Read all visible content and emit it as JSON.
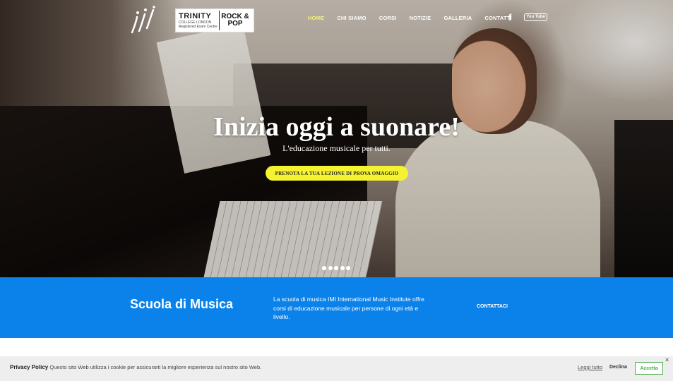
{
  "header": {
    "logo_alt": "IMI",
    "partner": {
      "name": "TRINITY",
      "sub": "COLLEGE LONDON",
      "sub2": "Registered Exam Centre",
      "badge": "ROCK & POP"
    },
    "nav": [
      {
        "label": "HOME",
        "active": true
      },
      {
        "label": "CHI SIAMO"
      },
      {
        "label": "CORSI"
      },
      {
        "label": "NOTIZIE"
      },
      {
        "label": "GALLERIA"
      },
      {
        "label": "CONTATTI"
      }
    ],
    "social": {
      "facebook": "f",
      "youtube": "You Tube"
    }
  },
  "hero": {
    "title": "Inizia oggi a suonare!",
    "subtitle": "L'educazione musicale per tutti.",
    "cta": "PRENOTA LA TUA LEZIONE DI PROVA OMAGGIO",
    "slides": 5
  },
  "band": {
    "title": "Scuola di Musica",
    "text": "La scuola di musica IMI International Music Institute offre corsi di educazione musicale per persone di ogni età e livello.",
    "link": "CONTATTACI",
    "color": "#0a82ea"
  },
  "cookie": {
    "title": "Privacy Policy",
    "text": "Questo sito Web utilizza i cookie per assicurarti la migliore esperienza sul nostro sito Web.",
    "read_more": "Leggi tutto",
    "decline": "Declina",
    "accept": "Accetta",
    "close": "×"
  },
  "colors": {
    "accent": "#f5f232",
    "active_nav": "#f7f36b",
    "accept": "#4caf50"
  }
}
